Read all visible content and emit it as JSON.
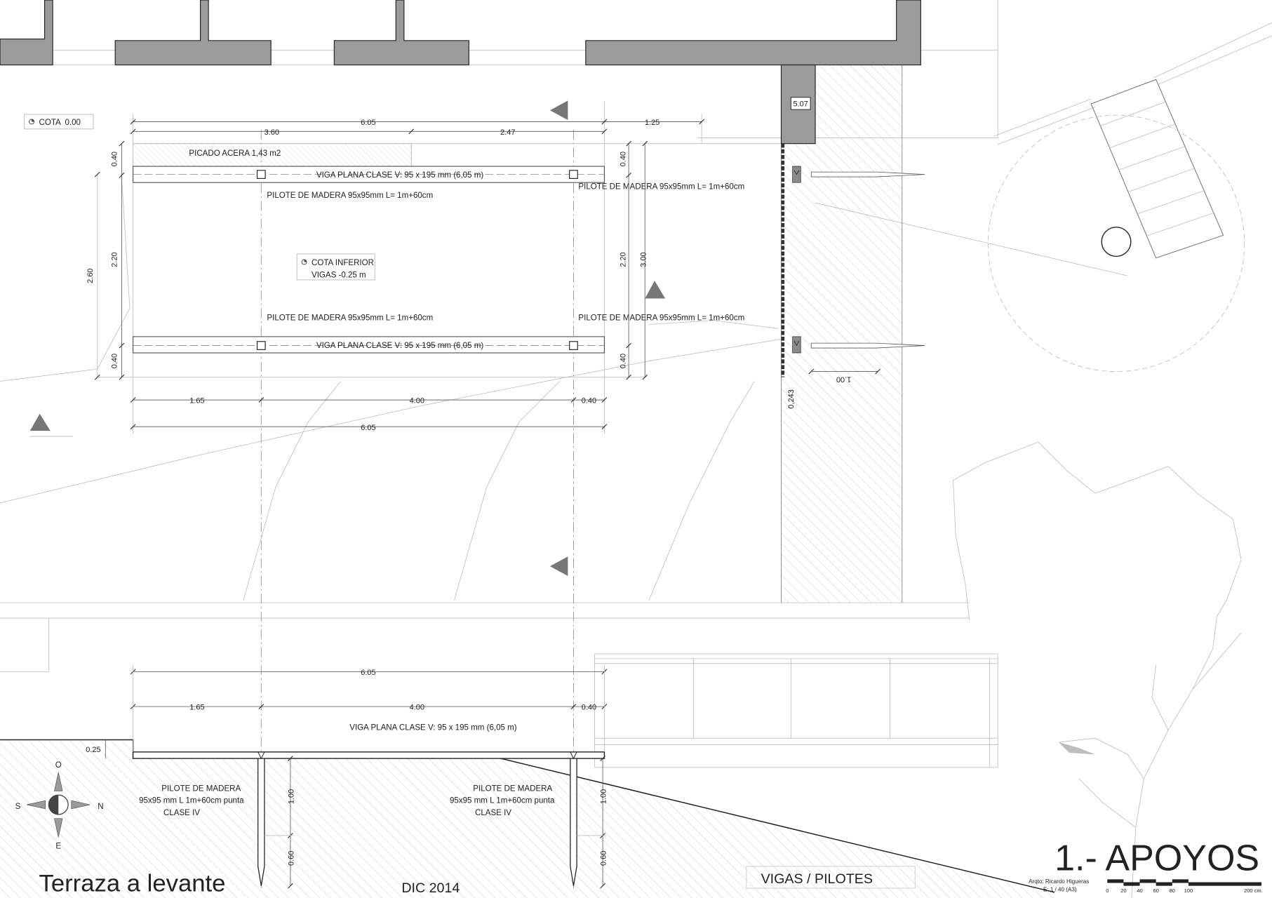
{
  "plan": {
    "cota_ref": "COTA  0.00",
    "cota_inferior": {
      "line1": "COTA INFERIOR",
      "line2": "VIGAS -0.25 m"
    },
    "picado": "PICADO ACERA 1,43 m2",
    "beam_label": "VIGA PLANA CLASE V: 95 x 195 mm (6,05 m)",
    "pile_label": "PILOTE DE MADERA 95x95mm L= 1m+60cm",
    "column_level": "5.07",
    "dims": {
      "top_total": "6.05",
      "top_ext": "1.25",
      "top_left": "3.60",
      "top_right": "2.47",
      "left_edge_top": "0.40",
      "left_middle": "2.20",
      "left_edge_bottom": "0.40",
      "left_total": "2.60",
      "right_edge_top": "0.40",
      "right_middle": "2.20",
      "right_edge_bottom": "0.40",
      "right_total": "3.00",
      "bottom_left": "1.65",
      "bottom_middle": "4.00",
      "bottom_right": "0.40",
      "bottom_total": "6.05",
      "edge_gap": "0,243",
      "anchor_length": "1.00"
    }
  },
  "section": {
    "beam_label": "VIGA PLANA CLASE V: 95 x 195 mm (6,05 m)",
    "pile_label": {
      "line1": "PILOTE DE MADERA",
      "line2": "95x95 mm L 1m+60cm punta",
      "line3": "CLASE IV"
    },
    "dims": {
      "total": "6.05",
      "left": "1.65",
      "middle": "4.00",
      "right": "0.40",
      "beam_depth": "0.25",
      "pile_upper": "1.00",
      "pile_tip": "0.60"
    }
  },
  "compass": {
    "top": "O",
    "left": "S",
    "right": "N",
    "bottom": "E"
  },
  "title_block": {
    "project": "Terraza a levante",
    "date": "DIC 2014",
    "subtitle": "VIGAS / PILOTES",
    "sheet_title": "1.- APOYOS",
    "author": "Arqto: Ricardo Higueras",
    "scale": "E: 1 / 40 (A3)",
    "scale_ticks": [
      "0",
      "20",
      "40",
      "60",
      "80",
      "100"
    ],
    "scale_end": "200 cm."
  },
  "colors": {
    "wall_fill": "#9b9b9b",
    "line": "#222222",
    "hatch": "#cfcfcf",
    "marker": "#777777"
  }
}
